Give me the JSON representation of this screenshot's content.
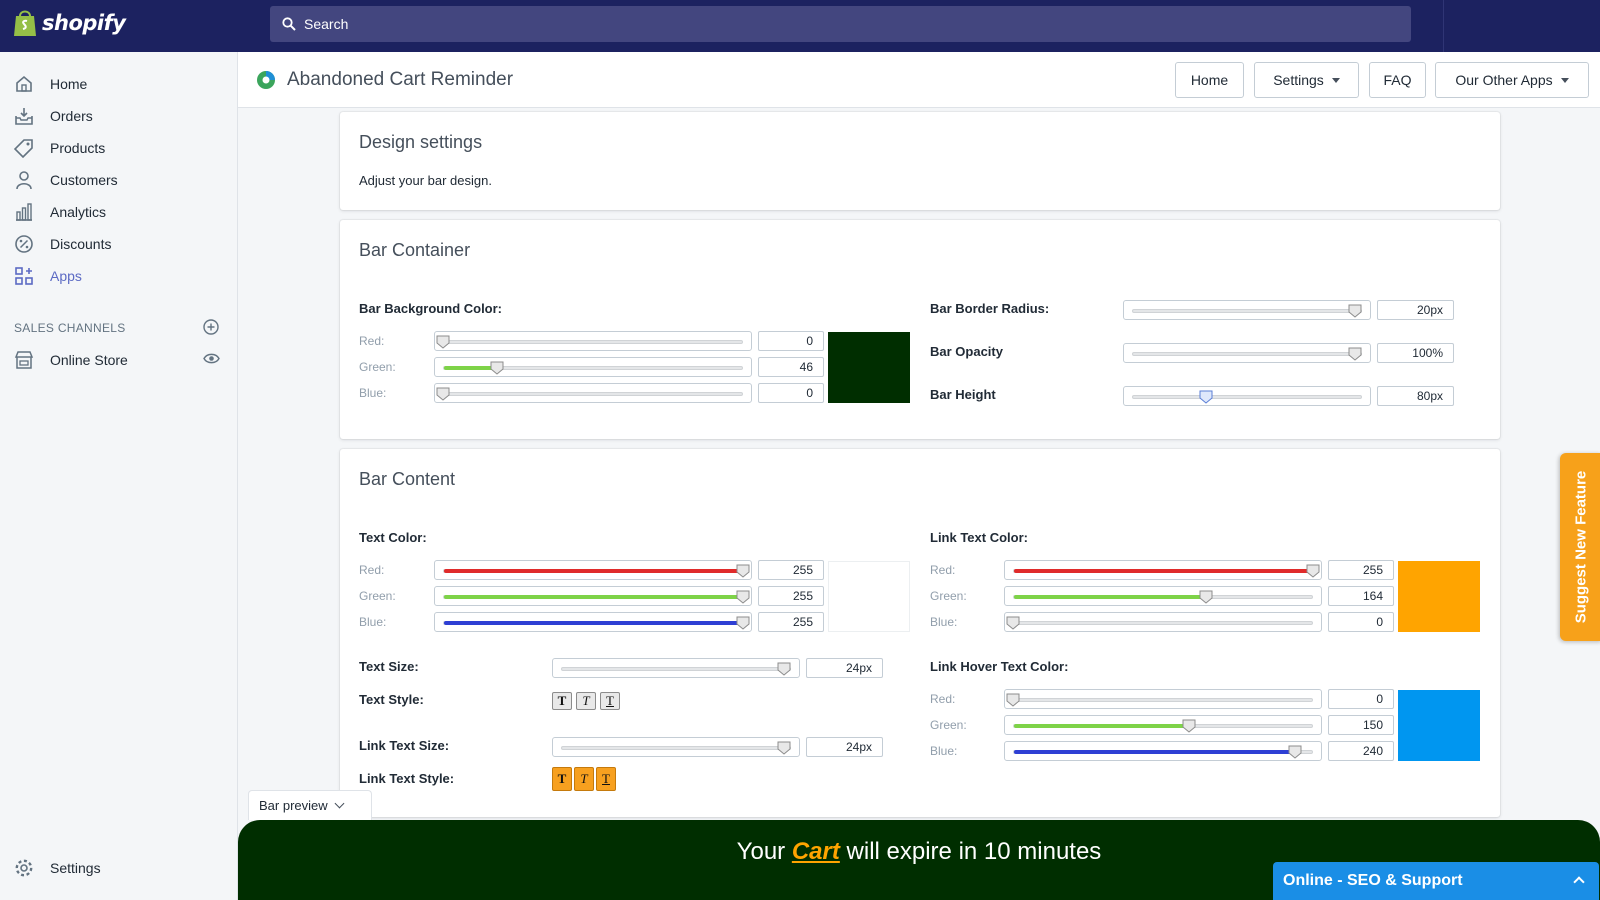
{
  "brand": {
    "name": "shopify"
  },
  "search": {
    "placeholder": "Search"
  },
  "sidebar": {
    "items": [
      {
        "label": "Home",
        "icon": "home-icon"
      },
      {
        "label": "Orders",
        "icon": "orders-icon"
      },
      {
        "label": "Products",
        "icon": "tag-icon"
      },
      {
        "label": "Customers",
        "icon": "person-icon"
      },
      {
        "label": "Analytics",
        "icon": "bar-chart-icon"
      },
      {
        "label": "Discounts",
        "icon": "discount-icon"
      },
      {
        "label": "Apps",
        "icon": "apps-icon"
      }
    ],
    "sales_channels_heading": "SALES CHANNELS",
    "online_store": "Online Store",
    "settings": "Settings"
  },
  "app": {
    "title": "Abandoned Cart Reminder",
    "buttons": {
      "home": "Home",
      "settings": "Settings",
      "faq": "FAQ",
      "other_apps": "Our Other Apps"
    }
  },
  "design": {
    "title": "Design settings",
    "subtitle": "Adjust your bar design."
  },
  "bar_container": {
    "title": "Bar Container",
    "bg_label": "Bar Background Color:",
    "channel_labels": {
      "red": "Red:",
      "green": "Green:",
      "blue": "Blue:"
    },
    "bg": {
      "red": "0",
      "green": "46",
      "blue": "0",
      "color": "#002e00"
    },
    "border_radius_label": "Bar Border Radius:",
    "border_radius_value": "20px",
    "border_radius_fraction": 0.97,
    "opacity_label": "Bar Opacity",
    "opacity_value": "100%",
    "opacity_fraction": 0.97,
    "height_label": "Bar Height",
    "height_value": "80px",
    "height_fraction": 0.32
  },
  "bar_content": {
    "title": "Bar Content",
    "text_color_label": "Text Color:",
    "text_color": {
      "red": "255",
      "green": "255",
      "blue": "255",
      "color": "#ffffff"
    },
    "text_size_label": "Text Size:",
    "text_size_value": "24px",
    "text_size_fraction": 0.97,
    "text_style_label": "Text Style:",
    "link_text_size_label": "Link Text Size:",
    "link_text_size_value": "24px",
    "link_text_size_fraction": 0.97,
    "link_text_style_label": "Link Text Style:",
    "link_text_color_label": "Link Text Color:",
    "link_text_color": {
      "red": "255",
      "green": "164",
      "blue": "0",
      "color": "#ffa400"
    },
    "link_hover_label": "Link Hover Text Color:",
    "link_hover_color": {
      "red": "0",
      "green": "150",
      "blue": "240",
      "color": "#0096f0"
    },
    "style_glyphs": {
      "bold": "T",
      "italic": "T",
      "underline": "T"
    }
  },
  "suggest": {
    "label": "Suggest New Feature"
  },
  "preview": {
    "tab_label": "Bar preview",
    "text_before": "Your",
    "link_text": "Cart",
    "text_after": "will expire in 10 minutes"
  },
  "chat": {
    "label": "Online - SEO & Support"
  }
}
